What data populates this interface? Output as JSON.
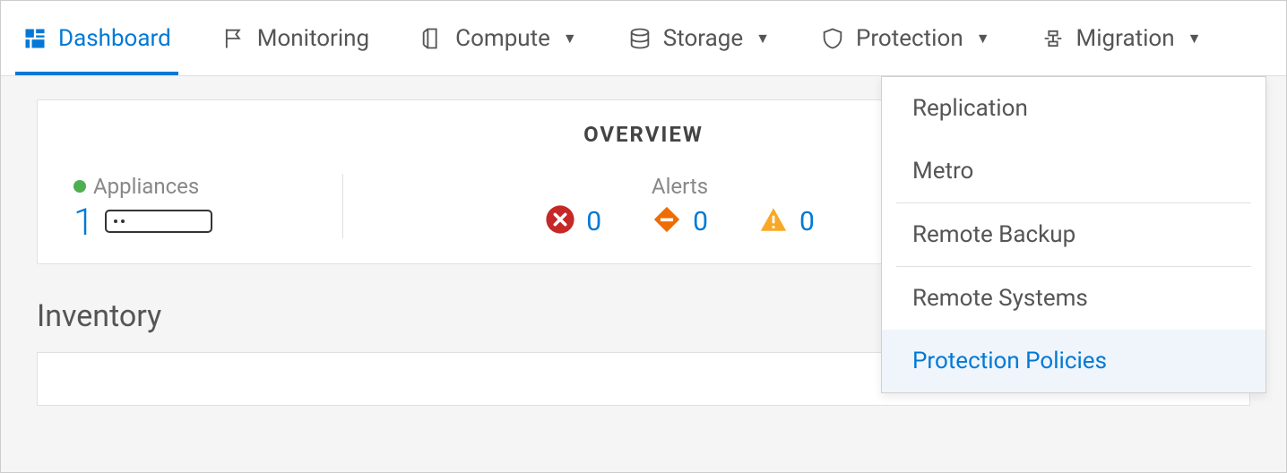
{
  "nav": {
    "dashboard": "Dashboard",
    "monitoring": "Monitoring",
    "compute": "Compute",
    "storage": "Storage",
    "protection": "Protection",
    "migration": "Migration"
  },
  "overview": {
    "title": "OVERVIEW",
    "appliances_label": "Appliances",
    "appliances_count": "1",
    "alerts_label": "Alerts",
    "alerts": {
      "critical": "0",
      "major": "0",
      "warning": "0"
    }
  },
  "inventory_heading": "Inventory",
  "protection_menu": {
    "replication": "Replication",
    "metro": "Metro",
    "remote_backup": "Remote Backup",
    "remote_systems": "Remote Systems",
    "protection_policies": "Protection Policies"
  }
}
